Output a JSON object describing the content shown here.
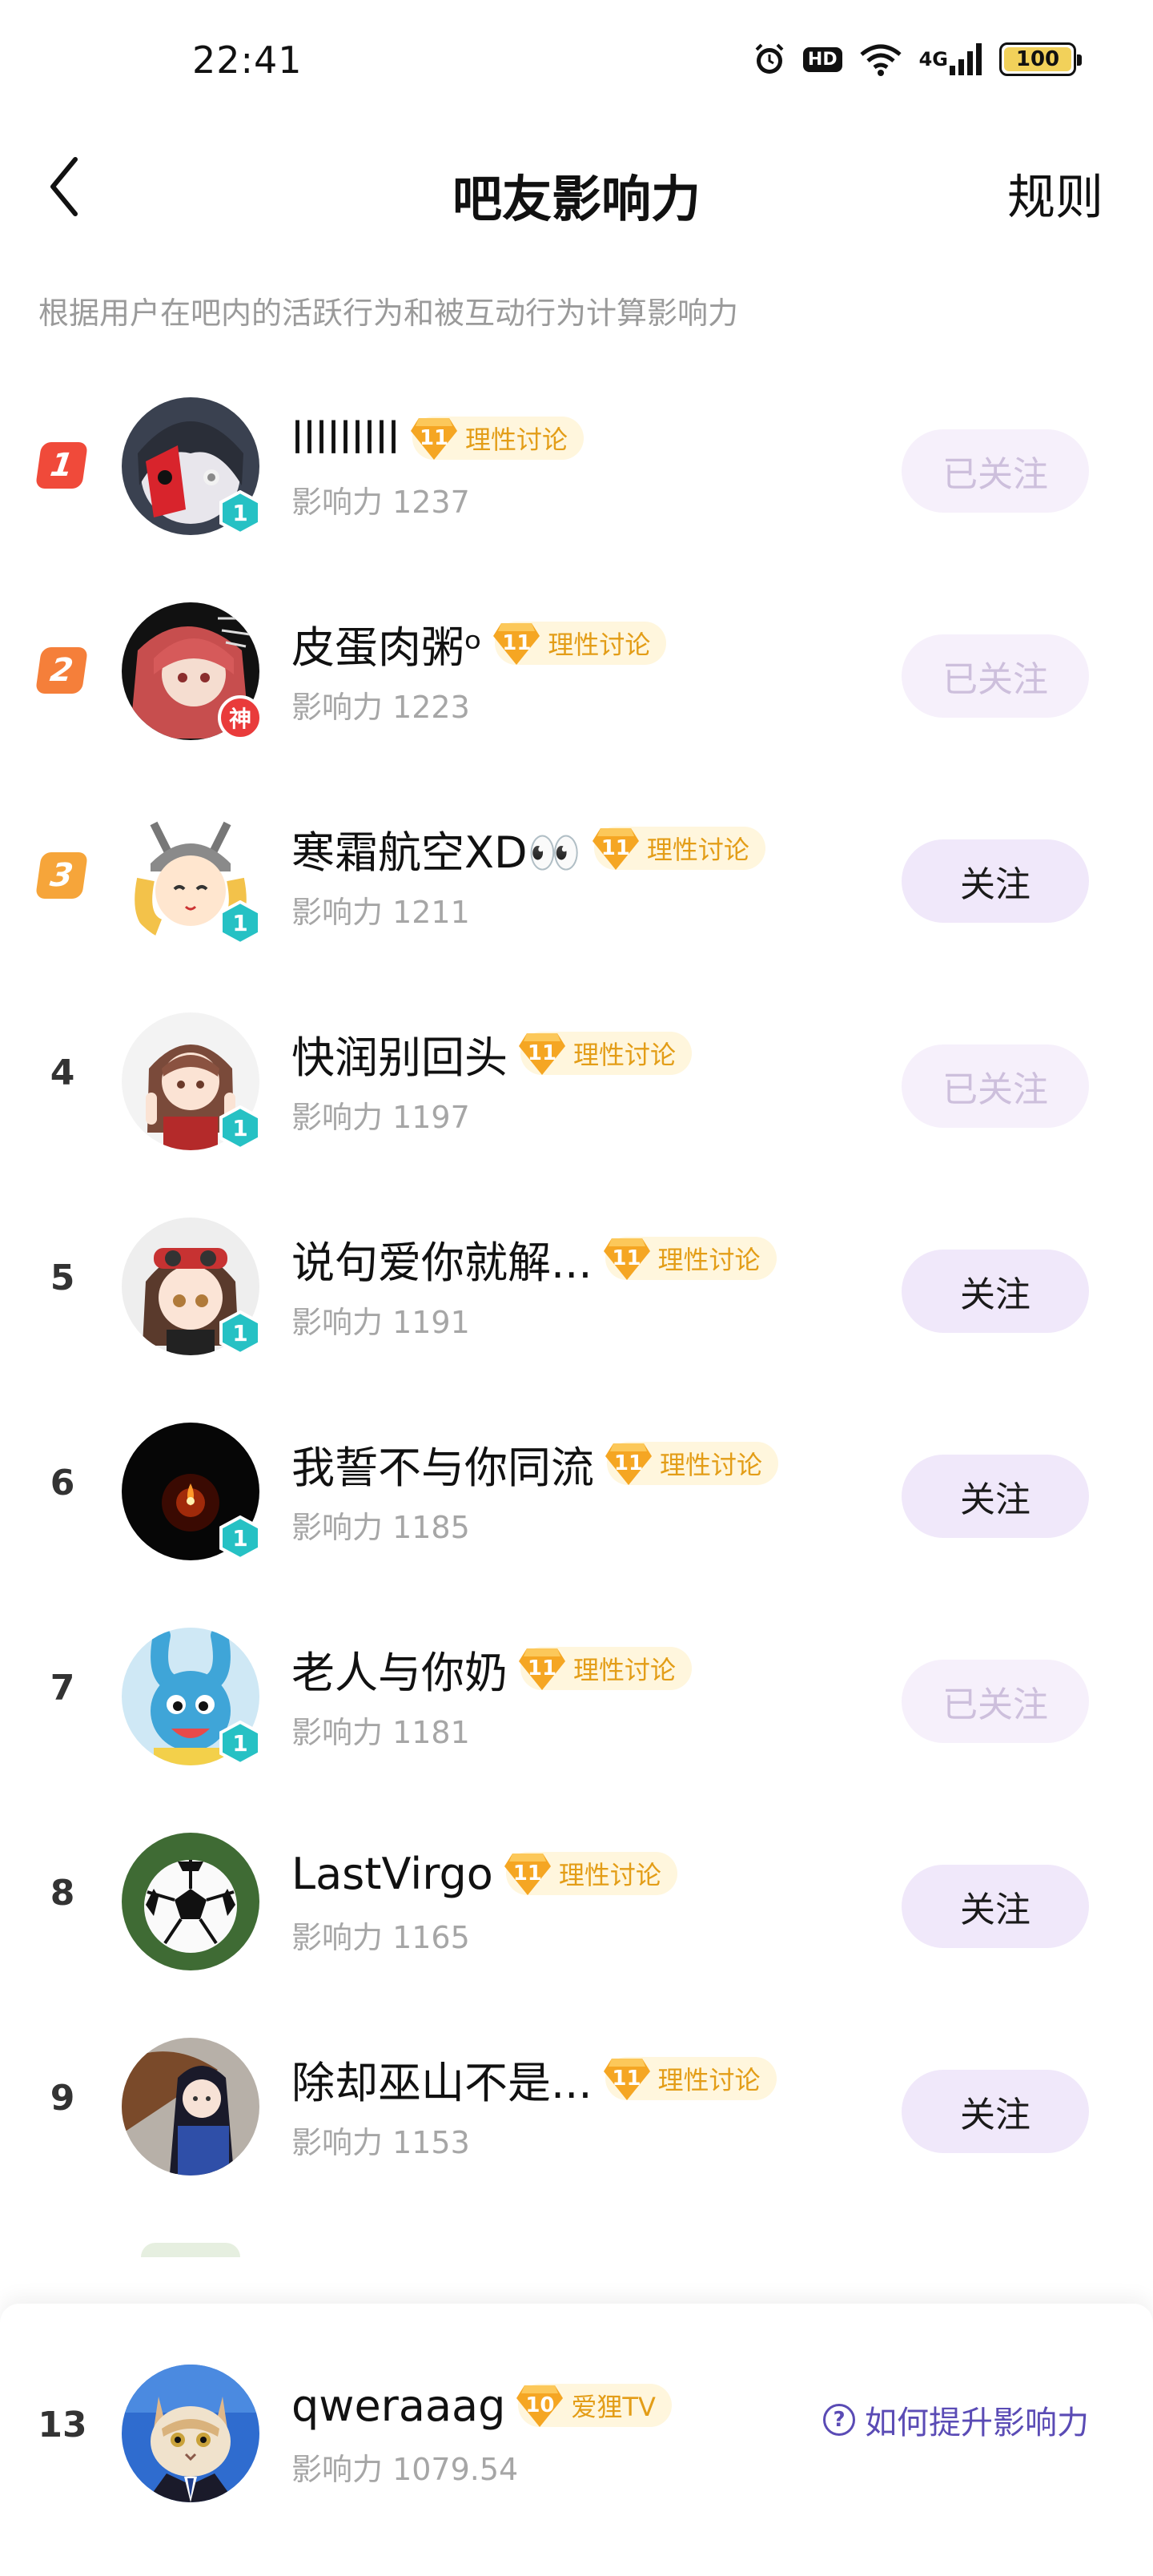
{
  "status": {
    "time": "22:41",
    "hd": "HD",
    "net": "4G",
    "battery": "100"
  },
  "nav": {
    "title": "吧友影响力",
    "rules": "规则"
  },
  "description": "根据用户在吧内的活跃行为和被互动行为计算影响力",
  "influence_prefix": "影响力",
  "colors": {
    "gold": "#e39d17",
    "rank1": "#f04a3a",
    "rank2": "#f57f3a",
    "rank3": "#f6a53a",
    "followed": "#cdbfdc",
    "link": "#5a4bb5"
  },
  "rows": [
    {
      "rank": "1",
      "name": "lllllllll",
      "level": "11",
      "title": "理性讨论",
      "influence": "影响力 1237",
      "follow": "已关注",
      "followed": true,
      "badge": "1",
      "avatar": "red-mask-character"
    },
    {
      "rank": "2",
      "name": "皮蛋肉粥ᵒ",
      "level": "11",
      "title": "理性讨论",
      "influence": "影响力 1223",
      "follow": "已关注",
      "followed": true,
      "badge": "神",
      "avatar": "red-hair-anime-girl"
    },
    {
      "rank": "3",
      "name": "寒霜航空XD👀",
      "level": "11",
      "title": "理性讨论",
      "influence": "影响力 1211",
      "follow": "关注",
      "followed": false,
      "badge": "1",
      "avatar": "chibi-helmet-girl"
    },
    {
      "rank": "4",
      "name": "快润别回头",
      "level": "11",
      "title": "理性讨论",
      "influence": "影响力 1197",
      "follow": "已关注",
      "followed": true,
      "badge": "1",
      "avatar": "anime-girl-brown-hair"
    },
    {
      "rank": "5",
      "name": "说句爱你就解...",
      "level": "11",
      "title": "理性讨论",
      "influence": "影响力 1191",
      "follow": "关注",
      "followed": false,
      "badge": "1",
      "avatar": "goggles-anime-girl"
    },
    {
      "rank": "6",
      "name": "我誓不与你同流",
      "level": "11",
      "title": "理性讨论",
      "influence": "影响力 1185",
      "follow": "关注",
      "followed": false,
      "badge": "1",
      "avatar": "candle-dark"
    },
    {
      "rank": "7",
      "name": "老人与你奶",
      "level": "11",
      "title": "理性讨论",
      "influence": "影响力 1181",
      "follow": "已关注",
      "followed": true,
      "badge": "1",
      "avatar": "blue-bunny-cartoon"
    },
    {
      "rank": "8",
      "name": "LastVirgo",
      "level": "11",
      "title": "理性讨论",
      "influence": "影响力 1165",
      "follow": "关注",
      "followed": false,
      "badge": "",
      "avatar": "soccer-ball"
    },
    {
      "rank": "9",
      "name": "除却巫山不是...",
      "level": "11",
      "title": "理性讨论",
      "influence": "影响力 1153",
      "follow": "关注",
      "followed": false,
      "badge": "",
      "avatar": "anime-girl-umbrella"
    }
  ],
  "me": {
    "rank": "13",
    "name": "qweraaag",
    "level": "10",
    "title": "爱狸TV",
    "influence": "影响力 1079.54",
    "help": "如何提升影响力",
    "avatar": "cat-in-suit"
  }
}
